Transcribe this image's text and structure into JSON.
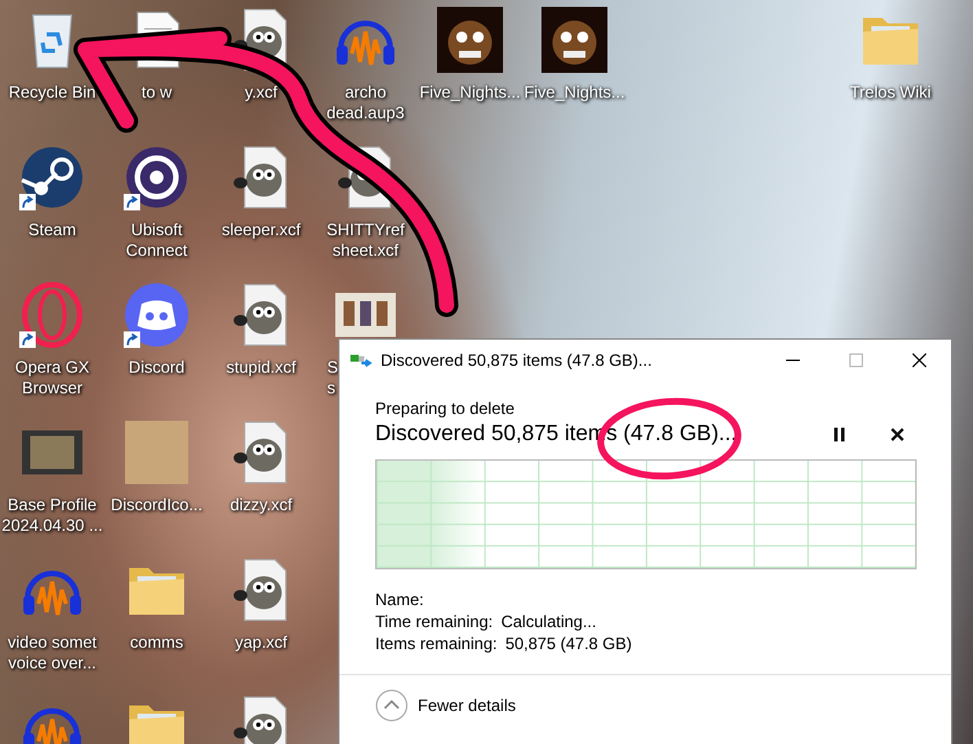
{
  "desktop": {
    "columns": [
      [
        {
          "kind": "recycle",
          "label": "Recycle Bin",
          "shortcut": false
        },
        {
          "kind": "steam",
          "label": "Steam",
          "shortcut": true
        },
        {
          "kind": "opera",
          "label": "Opera GX Browser",
          "shortcut": true
        },
        {
          "kind": "film",
          "label": "Base Profile 2024.04.30 ...",
          "shortcut": false
        },
        {
          "kind": "audio",
          "label": "video somet voice over...",
          "shortcut": false
        },
        {
          "kind": "audio"
        }
      ],
      [
        {
          "kind": "doc",
          "label": "to w",
          "shortcut": false
        },
        {
          "kind": "ubisoft",
          "label": "Ubisoft Connect",
          "shortcut": true
        },
        {
          "kind": "discord",
          "label": "Discord",
          "shortcut": true
        },
        {
          "kind": "photo",
          "label": "DiscordIco...",
          "shortcut": false
        },
        {
          "kind": "folder",
          "label": "comms",
          "shortcut": false
        },
        {
          "kind": "folder"
        }
      ],
      [
        {
          "kind": "gimp",
          "label": "y.xcf",
          "shortcut": false
        },
        {
          "kind": "gimp",
          "label": "sleeper.xcf",
          "shortcut": false
        },
        {
          "kind": "gimp",
          "label": "stupid.xcf",
          "shortcut": false
        },
        {
          "kind": "gimp",
          "label": "dizzy.xcf",
          "shortcut": false
        },
        {
          "kind": "gimp",
          "label": "yap.xcf",
          "shortcut": false
        },
        {
          "kind": "gimp"
        }
      ],
      [
        {
          "kind": "audio",
          "label": "archo dead.aup3",
          "shortcut": false
        },
        {
          "kind": "gimp",
          "label": "SHITTYref sheet.xcf",
          "shortcut": false
        },
        {
          "kind": "thumb",
          "label": "S\ns",
          "shortcut": false
        }
      ],
      [
        {
          "kind": "game",
          "label": "Five_Nights...",
          "shortcut": false
        }
      ],
      [
        {
          "kind": "game",
          "label": "Five_Nights...",
          "shortcut": false
        }
      ]
    ],
    "right_icons": [
      {
        "kind": "folder",
        "label": "Trelos Wiki",
        "shortcut": false
      }
    ]
  },
  "dialog": {
    "title": "Discovered 50,875 items (47.8 GB)...",
    "status": "Preparing to delete",
    "heading": "Discovered 50,875 items (47.8 GB)...",
    "progress": {
      "level": 0.2
    },
    "details": [
      {
        "label": "Name:"
      },
      {
        "label": "Time remaining:",
        "value": "Calculating..."
      },
      {
        "label": "Items remaining:",
        "value": "50,875 (47.8 GB)"
      }
    ],
    "toggle": "Fewer details"
  }
}
